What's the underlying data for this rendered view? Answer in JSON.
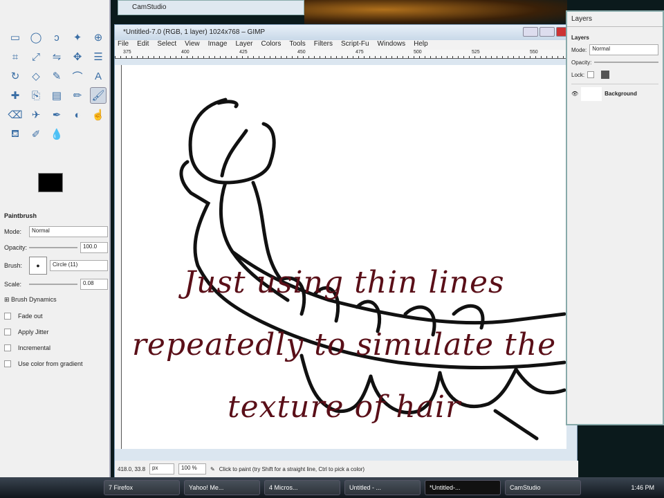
{
  "camstudio_window_title": "CamStudio",
  "toolbox": {
    "tools": [
      "rect-select",
      "ellipse-select",
      "free-select",
      "fuzzy-select",
      "zoom",
      "crop",
      "scale",
      "flip",
      "move",
      "align",
      "rotate",
      "perspective",
      "color-picker",
      "measure",
      "text",
      "heal",
      "clone",
      "blend",
      "pencil",
      "paintbrush",
      "eraser",
      "airbrush",
      "ink",
      "dodge",
      "smudge",
      "bucket",
      "path",
      "blur"
    ],
    "tool_options": {
      "title": "Paintbrush",
      "mode_label": "Mode:",
      "mode_value": "Normal",
      "opacity_label": "Opacity:",
      "opacity_value": "100.0",
      "brush_label": "Brush:",
      "brush_value": "Circle (11)",
      "scale_label": "Scale:",
      "scale_value": "0.08",
      "brush_dynamics": "Brush Dynamics",
      "checkboxes": [
        "Fade out",
        "Apply Jitter",
        "Incremental",
        "Use color from gradient"
      ]
    }
  },
  "image_window": {
    "title": "*Untitled-7.0 (RGB, 1 layer) 1024x768 – GIMP",
    "menu": [
      "File",
      "Edit",
      "Select",
      "View",
      "Image",
      "Layer",
      "Colors",
      "Tools",
      "Filters",
      "Script-Fu",
      "Windows",
      "Help"
    ],
    "ruler_labels": [
      "375",
      "400",
      "425",
      "450",
      "475",
      "500",
      "525",
      "550"
    ],
    "caption_lines": [
      "Just using thin lines",
      "repeatedly to simulate the",
      "texture of hair"
    ],
    "status": {
      "coords": "418.0, 33.8",
      "unit": "px",
      "zoom": "100 %",
      "message": "Click to paint (try Shift for a straight line, Ctrl to pick a color)"
    }
  },
  "layers_dock": {
    "title": "Layers",
    "tab": "Layers",
    "mode_label": "Mode:",
    "mode_value": "Normal",
    "opacity_label": "Opacity:",
    "lock_label": "Lock:",
    "layer_name": "Background"
  },
  "taskbar": {
    "items": [
      "7 Firefox",
      "Yahoo! Me...",
      "4 Micros...",
      "Untitled - ...",
      "*Untitled-...",
      "CamStudio"
    ],
    "active_index": 4,
    "clock": "1:46 PM"
  }
}
